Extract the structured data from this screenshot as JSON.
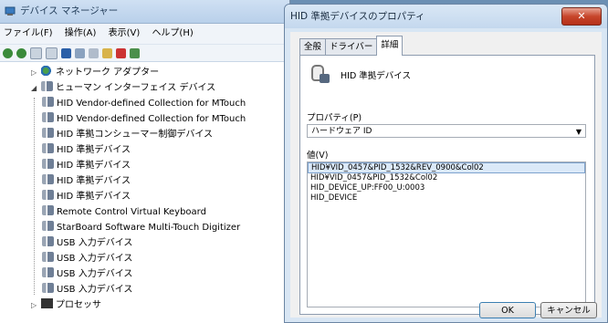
{
  "device_manager": {
    "title": "デバイス マネージャー",
    "menu": [
      "ファイル(F)",
      "操作(A)",
      "表示(V)",
      "ヘルプ(H)"
    ],
    "tree": [
      {
        "label": "ネットワーク アダプター",
        "icon": "network-adapter-icon",
        "expander": "▷"
      },
      {
        "label": "ヒューマン インターフェイス デバイス",
        "icon": "hid-category-icon",
        "expander": "◢"
      },
      {
        "label": "HID Vendor-defined Collection for MTouch",
        "icon": "hid-device-icon"
      },
      {
        "label": "HID Vendor-defined Collection for MTouch",
        "icon": "hid-device-icon"
      },
      {
        "label": "HID 準拠コンシューマー制御デバイス",
        "icon": "hid-device-icon"
      },
      {
        "label": "HID 準拠デバイス",
        "icon": "hid-device-icon"
      },
      {
        "label": "HID 準拠デバイス",
        "icon": "hid-device-icon"
      },
      {
        "label": "HID 準拠デバイス",
        "icon": "hid-device-icon"
      },
      {
        "label": "HID 準拠デバイス",
        "icon": "hid-device-icon"
      },
      {
        "label": "Remote Control Virtual Keyboard",
        "icon": "hid-device-icon"
      },
      {
        "label": "StarBoard Software Multi-Touch Digitizer",
        "icon": "hid-device-icon"
      },
      {
        "label": "USB 入力デバイス",
        "icon": "hid-device-icon"
      },
      {
        "label": "USB 入力デバイス",
        "icon": "hid-device-icon"
      },
      {
        "label": "USB 入力デバイス",
        "icon": "hid-device-icon"
      },
      {
        "label": "USB 入力デバイス",
        "icon": "hid-device-icon"
      },
      {
        "label": "プロセッサ",
        "icon": "processor-icon",
        "expander": "▷"
      }
    ]
  },
  "dialog": {
    "title": "HID 準拠デバイスのプロパティ",
    "close_label": "✕",
    "tabs": [
      "全般",
      "ドライバー",
      "詳細"
    ],
    "active_tab": "詳細",
    "device_name": "HID 準拠デバイス",
    "property_label": "プロパティ(P)",
    "property_value": "ハードウェア ID",
    "value_label": "値(V)",
    "values": [
      "HID¥VID_0457&PID_1532&REV_0900&Col02",
      "HID¥VID_0457&PID_1532&Col02",
      "HID_DEVICE_UP:FF00_U:0003",
      "HID_DEVICE"
    ],
    "selected_value_index": 0,
    "ok_label": "OK",
    "cancel_label": "キャンセル"
  }
}
